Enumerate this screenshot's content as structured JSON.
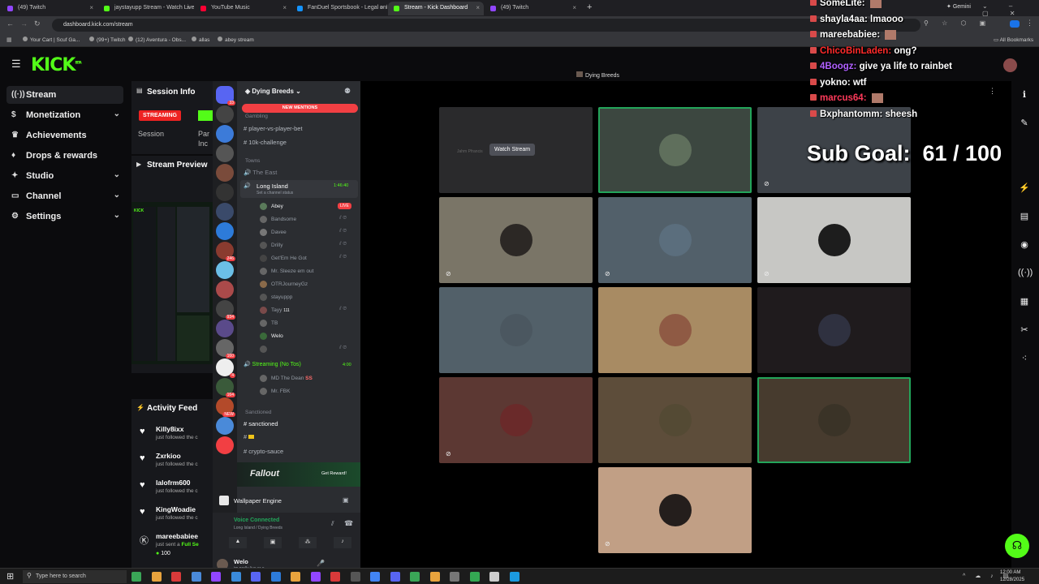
{
  "browser": {
    "tabs": [
      {
        "title": "(49) Twitch",
        "color": "#9146ff"
      },
      {
        "title": "jaystayupp Stream - Watch Live",
        "color": "#53fc18"
      },
      {
        "title": "YouTube Music",
        "color": "#ff0033"
      },
      {
        "title": "FanDuel Sportsbook - Legal onl",
        "color": "#1493ff"
      },
      {
        "title": "Stream - Kick Dashboard",
        "color": "#53fc18",
        "active": true
      },
      {
        "title": "(49) Twitch",
        "color": "#9146ff"
      }
    ],
    "new_tab": "+",
    "gemini_label": "Gemini",
    "url": "dashboard.kick.com/stream",
    "bookmarks": [
      "Your Cart | Scuf Ga...",
      "(99+) Twitch",
      "(12) Aventura - Obs...",
      "allas",
      "abey stream"
    ],
    "all_bookmarks": "All Bookmarks"
  },
  "kick": {
    "logo": "KICK",
    "logo_sup": "BETA",
    "nav": [
      {
        "label": "Stream",
        "icon": "stream-icon",
        "glyph": "((·))",
        "active": true,
        "chevron": false
      },
      {
        "label": "Monetization",
        "icon": "dollar-icon",
        "glyph": "$",
        "active": false,
        "chevron": true
      },
      {
        "label": "Achievements",
        "icon": "trophy-icon",
        "glyph": "♛",
        "active": false,
        "chevron": false
      },
      {
        "label": "Drops & rewards",
        "icon": "gift-icon",
        "glyph": "♦",
        "active": false,
        "chevron": false
      },
      {
        "label": "Studio",
        "icon": "gear-icon",
        "glyph": "✦",
        "active": false,
        "chevron": true
      },
      {
        "label": "Channel",
        "icon": "tv-icon",
        "glyph": "▭",
        "active": false,
        "chevron": true
      },
      {
        "label": "Settings",
        "icon": "settings-icon",
        "glyph": "⚙",
        "active": false,
        "chevron": true
      }
    ],
    "session_info": {
      "title": "Session Info",
      "status_badge": "STREAMING",
      "session_label": "Session",
      "partial_label": "Par",
      "partial_label2": "Inc"
    },
    "stream_preview": {
      "title": "Stream Preview"
    },
    "activity_feed": {
      "title": "Activity Feed",
      "items": [
        {
          "name": "Killy8ixx",
          "action": "just followed the c"
        },
        {
          "name": "Zxrkioo",
          "action": "just followed the c"
        },
        {
          "name": "lalofrm600",
          "action": "just followed the c"
        },
        {
          "name": "KingWoadie",
          "action": "just followed the c"
        },
        {
          "name": "mareebabiee",
          "action": "just sent a",
          "highlight": "Full Se",
          "amount": "100"
        }
      ]
    }
  },
  "discord": {
    "server_name": "Dying Breeds",
    "new_mentions": "NEW MENTIONS",
    "server_badges": [
      "33",
      "",
      "",
      "",
      "",
      "",
      "",
      "",
      "246",
      "",
      "",
      "934",
      "",
      "160",
      "4",
      "164",
      "NEW"
    ],
    "channels": {
      "cat_gambling": "Gambling",
      "pvp": "player-vs-player-bet",
      "challenge": "10k-challenge",
      "cat_towns": "Towns",
      "the_east": "The East",
      "long_island": "Long Island",
      "long_island_time": "1:46:40",
      "long_island_status": "Set a channel status",
      "users": [
        "Abey",
        "Bandsome",
        "Davee",
        "Drilly",
        "Get'Em He Got",
        "Mr. Sleeze em out",
        "OTRJourneyGz",
        "stayuppp",
        "Tayy",
        "TB",
        "Welo",
        ""
      ],
      "live_badge": "LIVE",
      "tayy_badge": "111",
      "streaming_channel": "Streaming (No Tos)",
      "streaming_time": "4:00",
      "streaming_users": [
        "MD The Dean",
        "Mr. FBK"
      ],
      "streaming_badge": "SS",
      "cat_sanctioned": "Sanctioned",
      "sanctioned": "sanctioned",
      "crypto": "crypto-sauce"
    },
    "promo": {
      "title": "Fallout",
      "button": "Get Reward!"
    },
    "wallpaper": "Wallpaper Engine",
    "voice": {
      "status": "Voice Connected",
      "location": "Long Island / Dying Breeds"
    },
    "user": {
      "name": "Welo",
      "status": "im prolly live or o..."
    }
  },
  "call": {
    "channel_title": "Dying Breeds",
    "watch_stream": "Watch Stream",
    "ghost_name": "Jahm Pfrancis",
    "tiles": [
      {
        "bg": "#2a2a2c",
        "avatar": null,
        "border": false,
        "ghost": true
      },
      {
        "bg": "#3c4740",
        "avatar": "#5f6f5c",
        "border": true,
        "mute": false
      },
      {
        "bg": "#3d4248",
        "avatar": null,
        "border": false,
        "mute": true
      },
      {
        "bg": "#7a7567",
        "avatar": "#2c2825",
        "border": false,
        "mute": true
      },
      {
        "bg": "#52606a",
        "avatar": "#5b6e7d",
        "border": false,
        "mute": true
      },
      {
        "bg": "#c7c7c4",
        "avatar": "#1d1d1d",
        "border": false,
        "mute": true
      },
      {
        "bg": "#526069",
        "avatar": "#4b5760",
        "border": false,
        "mute": false
      },
      {
        "bg": "#a88b63",
        "avatar": "#8f5a44",
        "border": false,
        "mute": false
      },
      {
        "bg": "#1f1b1d",
        "avatar": "#2f3140",
        "border": false,
        "mute": false
      },
      {
        "bg": "#5c3833",
        "avatar": "#6a2a2a",
        "border": false,
        "mute": true
      },
      {
        "bg": "#5d4d3a",
        "avatar": "#544a34",
        "border": false,
        "mute": false
      },
      {
        "bg": "#473b2e",
        "avatar": "#3a3327",
        "border": true,
        "mute": false
      },
      {
        "bg": "#c19f85",
        "avatar": "#241e1c",
        "border": false,
        "mute": true
      }
    ]
  },
  "chat_overlay": {
    "lines": [
      {
        "user": "SomeLite:",
        "msg": "",
        "color": "#ffffff",
        "emote": true
      },
      {
        "user": "shayla4aa:",
        "msg": "lmaooo",
        "color": "#ffffff"
      },
      {
        "user": "mareebabiee:",
        "msg": "",
        "color": "#ffffff",
        "emote": true
      },
      {
        "user": "ChicoBinLaden:",
        "msg": "ong?",
        "color": "#ff2a2a"
      },
      {
        "user": "4Boogz:",
        "msg": "give ya life to rainbet",
        "color": "#b060ff"
      },
      {
        "user": "yokno:",
        "msg": "wtf",
        "color": "#ffffff"
      },
      {
        "user": "marcus64:",
        "msg": "",
        "color": "#ff3a5a",
        "emote": true
      },
      {
        "user": "Bxphantomm:",
        "msg": "sheesh",
        "color": "#ffffff"
      }
    ],
    "sub_goal": "Sub Goal:  61 / 100"
  },
  "taskbar": {
    "search": "Type here to search",
    "time": "12:00 AM",
    "date": "12/28/2025"
  }
}
